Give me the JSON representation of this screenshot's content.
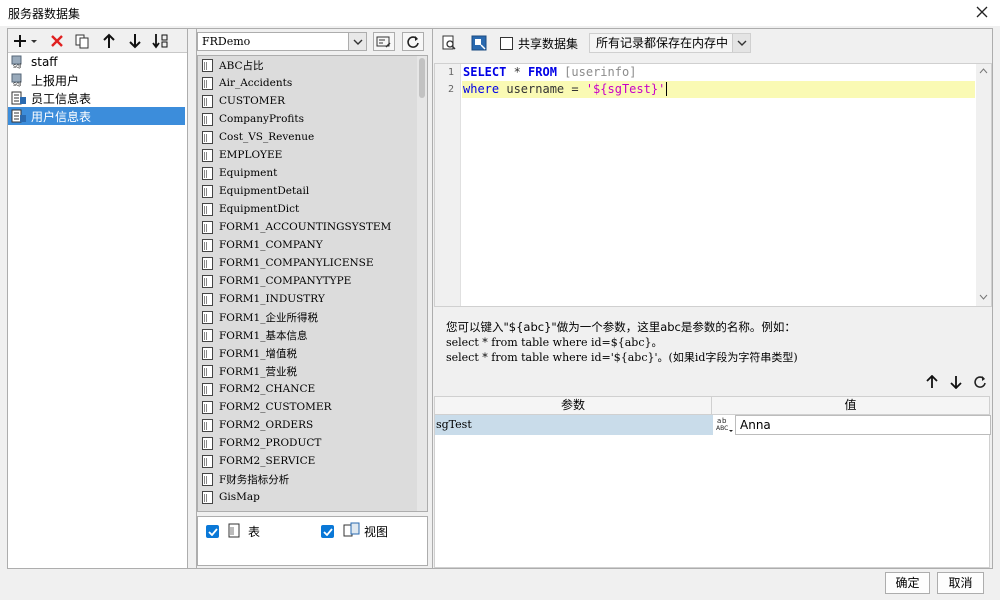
{
  "window": {
    "title": "服务器数据集"
  },
  "colors": {
    "selection": "#3c8ddb",
    "checkbox": "#0a78d7",
    "keyword": "#0000e6",
    "string": "#c800c8",
    "active_line": "#fafab4",
    "param_name_bg": "#c9dcea"
  },
  "left": {
    "datasets": [
      {
        "label": "staff",
        "icon": "db-table-icon"
      },
      {
        "label": "上报用户",
        "icon": "db-table-icon"
      },
      {
        "label": "员工信息表",
        "icon": "report-icon"
      },
      {
        "label": "用户信息表",
        "icon": "report-icon",
        "selected": true
      }
    ]
  },
  "middle": {
    "connection": "FRDemo",
    "tables": [
      "ABC占比",
      "Air_Accidents",
      "CUSTOMER",
      "CompanyProfits",
      "Cost_VS_Revenue",
      "EMPLOYEE",
      "Equipment",
      "EquipmentDetail",
      "EquipmentDict",
      "FORM1_ACCOUNTINGSYSTEM",
      "FORM1_COMPANY",
      "FORM1_COMPANYLICENSE",
      "FORM1_COMPANYTYPE",
      "FORM1_INDUSTRY",
      "FORM1_企业所得税",
      "FORM1_基本信息",
      "FORM1_增值税",
      "FORM1_营业税",
      "FORM2_CHANCE",
      "FORM2_CUSTOMER",
      "FORM2_ORDERS",
      "FORM2_PRODUCT",
      "FORM2_SERVICE",
      "F财务指标分析",
      "GisMap"
    ],
    "show_tables_label": "表",
    "show_views_label": "视图"
  },
  "right": {
    "share_label": "共享数据集",
    "storage_mode": "所有记录都保存在内存中",
    "code": {
      "line_numbers": [
        "1",
        "2"
      ],
      "line1": {
        "kw1": "SELECT",
        "mid": " * ",
        "kw2": "FROM",
        "table": " [userinfo]"
      },
      "line2": {
        "kw": "where",
        "ident": " username = ",
        "str": "'${sgTest}'"
      }
    },
    "hint": {
      "line1": "您可以键入\"${abc}\"做为一个参数，这里abc是参数的名称。例如：",
      "line2": "select * from table where id=${abc}。",
      "line3": "select * from table where id='${abc}'。(如果id字段为字符串类型)"
    },
    "params": {
      "header_name": "参数",
      "header_value": "值",
      "rows": [
        {
          "name": "sgTest",
          "type_line1": "ᴬᴮᶜ",
          "value": "Anna"
        }
      ]
    }
  },
  "footer": {
    "ok": "确定",
    "cancel": "取消"
  }
}
